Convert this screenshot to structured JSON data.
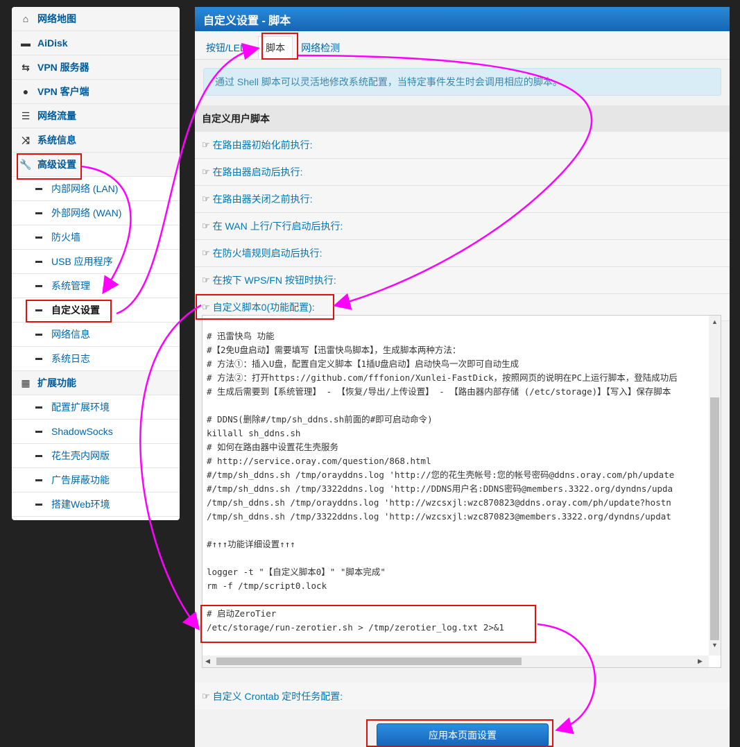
{
  "sidebar": {
    "items": [
      {
        "label": "网络地图",
        "icon": "home-icon",
        "type": "main"
      },
      {
        "label": "AiDisk",
        "icon": "disk-icon",
        "type": "main"
      },
      {
        "label": "VPN 服务器",
        "icon": "retweet-icon",
        "type": "main"
      },
      {
        "label": "VPN 客户端",
        "icon": "globe-icon",
        "type": "main"
      },
      {
        "label": "网络流量",
        "icon": "hdd-icon",
        "type": "main"
      },
      {
        "label": "系统信息",
        "icon": "random-icon",
        "type": "main"
      },
      {
        "label": "高级设置",
        "icon": "wrench-icon",
        "type": "main"
      },
      {
        "label": "内部网络 (LAN)",
        "type": "sub"
      },
      {
        "label": "外部网络 (WAN)",
        "type": "sub"
      },
      {
        "label": "防火墙",
        "type": "sub"
      },
      {
        "label": "USB 应用程序",
        "type": "sub"
      },
      {
        "label": "系统管理",
        "type": "sub"
      },
      {
        "label": "自定义设置",
        "type": "sub",
        "active": true
      },
      {
        "label": "网络信息",
        "type": "sub"
      },
      {
        "label": "系统日志",
        "type": "sub"
      },
      {
        "label": "扩展功能",
        "icon": "grid-icon",
        "type": "main"
      },
      {
        "label": "配置扩展环境",
        "type": "sub"
      },
      {
        "label": "ShadowSocks",
        "type": "sub"
      },
      {
        "label": "花生壳内网版",
        "type": "sub"
      },
      {
        "label": "广告屏蔽功能",
        "type": "sub"
      },
      {
        "label": "搭建Web环境",
        "type": "sub"
      }
    ]
  },
  "panel": {
    "title": "自定义设置 - 脚本",
    "tabs": [
      "按钮/LED",
      "脚本",
      "网络检测"
    ],
    "active_tab": 1,
    "alert": "通过 Shell 脚本可以灵活地修改系统配置，当特定事件发生时会调用相应的脚本。",
    "section_title": "自定义用户脚本",
    "rows": [
      "在路由器初始化前执行:",
      "在路由器启动后执行:",
      "在路由器关闭之前执行:",
      "在 WAN 上行/下行启动后执行:",
      "在防火墙规则启动后执行:",
      "在按下 WPS/FN 按钮时执行:",
      "自定义脚本0(功能配置):"
    ],
    "crontab_row": "自定义 Crontab 定时任务配置:",
    "apply_button": "应用本页面设置"
  },
  "editor": {
    "lines": [
      "# 迅雷快鸟 功能",
      "#【2免U盘启动】需要填写【迅雷快鸟脚本】，生成脚本两种方法：",
      "# 方法①：插入U盘，配置自定义脚本【1插U盘启动】启动快鸟一次即可自动生成",
      "# 方法②：打开https://github.com/fffonion/Xunlei-FastDick，按照网页的说明在PC上运行脚本，登陆成功后",
      "# 生成后需要到【系统管理】 - 【恢复/导出/上传设置】 - 【路由器内部存储 (/etc/storage)】【写入】保存脚本",
      "",
      "# DDNS(删除#/tmp/sh_ddns.sh前面的#即可启动命令)",
      "killall sh_ddns.sh",
      "# 如何在路由器中设置花生壳服务",
      "# http://service.oray.com/question/868.html",
      "#/tmp/sh_ddns.sh /tmp/orayddns.log 'http://您的花生壳帐号:您的帐号密码@ddns.oray.com/ph/update",
      "#/tmp/sh_ddns.sh /tmp/3322ddns.log 'http://DDNS用户名:DDNS密码@members.3322.org/dyndns/upda",
      "/tmp/sh_ddns.sh /tmp/orayddns.log 'http://wzcsxjl:wzc870823@ddns.oray.com/ph/update?hostn",
      "/tmp/sh_ddns.sh /tmp/3322ddns.log 'http://wzcsxjl:wzc870823@members.3322.org/dyndns/updat",
      "",
      "#↑↑↑功能详细设置↑↑↑",
      "",
      "logger -t \"【自定义脚本0】\" \"脚本完成\"",
      "rm -f /tmp/script0.lock",
      "",
      "# 启动ZeroTier",
      "/etc/storage/run-zerotier.sh > /tmp/zerotier_log.txt 2>&1"
    ]
  },
  "colors": {
    "highlight": "#e01010",
    "arrow": "#ff00ff",
    "title_bar": "#1a73c8",
    "link": "#0077b3"
  }
}
